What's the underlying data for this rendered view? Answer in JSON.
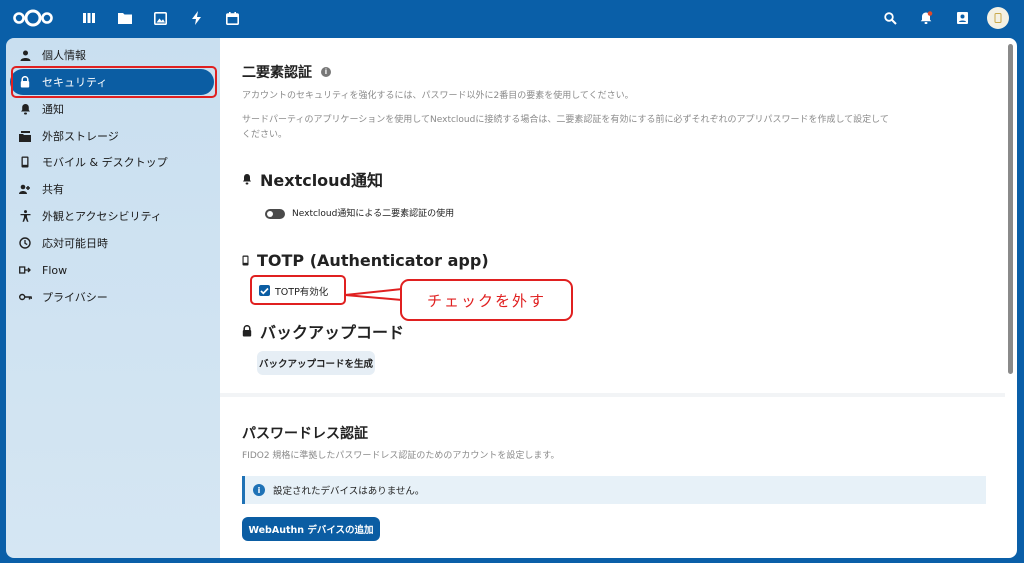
{
  "topbar": {
    "apps": [
      "dashboard-icon",
      "files-icon",
      "photos-icon",
      "activity-icon",
      "calendar-icon"
    ],
    "right": [
      "search-icon",
      "notifications-icon",
      "contacts-icon",
      "avatar"
    ]
  },
  "sidebar": {
    "items": [
      {
        "label": "個人情報",
        "icon": "person-icon"
      },
      {
        "label": "セキュリティ",
        "icon": "lock-icon",
        "active": true
      },
      {
        "label": "通知",
        "icon": "bell-icon"
      },
      {
        "label": "外部ストレージ",
        "icon": "storage-icon"
      },
      {
        "label": "モバイル & デスクトップ",
        "icon": "phone-icon"
      },
      {
        "label": "共有",
        "icon": "share-icon"
      },
      {
        "label": "外観とアクセシビリティ",
        "icon": "accessibility-icon"
      },
      {
        "label": "応対可能日時",
        "icon": "clock-icon"
      },
      {
        "label": "Flow",
        "icon": "flow-icon"
      },
      {
        "label": "プライバシー",
        "icon": "key-icon"
      }
    ]
  },
  "twofactor": {
    "title": "二要素認証",
    "desc1": "アカウントのセキュリティを強化するには、パスワード以外に2番目の要素を使用してください。",
    "desc2a": "サードパーティのアプリケーションを使用してNextcloudに接続する場合は、二要素認証を有効にする前に必ずそれぞれのアプリパスワードを作成して設定して",
    "desc2b": "ください。"
  },
  "nextcloud_notify": {
    "title": "Nextcloud通知",
    "toggle_label": "Nextcloud通知による二要素認証の使用"
  },
  "totp": {
    "title": "TOTP (Authenticator app)",
    "checkbox_label": "TOTP有効化"
  },
  "backup": {
    "title": "バックアップコード",
    "button": "バックアップコードを生成"
  },
  "passwordless": {
    "title": "パスワードレス認証",
    "desc": "FIDO2 規格に準拠したパスワードレス認証のためのアカウントを設定します。",
    "info": "設定されたデバイスはありません。",
    "button": "WebAuthn デバイスの追加"
  },
  "annotation": {
    "text": "チェックを外す"
  },
  "colors": {
    "brand": "#0a5fa8",
    "annotation": "#e02020"
  }
}
